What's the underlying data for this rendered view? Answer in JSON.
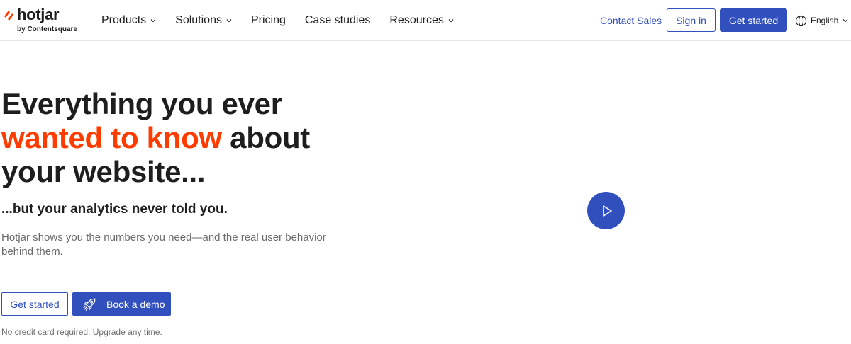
{
  "brand": {
    "name": "hotjar",
    "byline": "by Contentsquare",
    "accent": "#ff3c00",
    "primary": "#324fbe"
  },
  "nav": {
    "items": [
      {
        "label": "Products",
        "dropdown": true
      },
      {
        "label": "Solutions",
        "dropdown": true
      },
      {
        "label": "Pricing",
        "dropdown": false
      },
      {
        "label": "Case studies",
        "dropdown": false
      },
      {
        "label": "Resources",
        "dropdown": true
      }
    ]
  },
  "header_actions": {
    "contact_sales": "Contact Sales",
    "sign_in": "Sign in",
    "get_started": "Get started",
    "language": "English"
  },
  "hero": {
    "title_line1": "Everything you ever",
    "title_accent": "wanted to know",
    "title_line2_rest": " about",
    "title_line3": "your website...",
    "subtitle": "...but your analytics never told you.",
    "description": "Hotjar shows you the numbers you need—and the real user behavior behind them.",
    "cta_primary": "Get started",
    "cta_demo": "Book a demo",
    "fineprint": "No credit card required. Upgrade any time."
  },
  "icons": {
    "logo_mark": "hotjar-flame-icon",
    "chevron": "chevron-down-icon",
    "globe": "globe-icon",
    "rocket": "rocket-icon",
    "play": "play-icon"
  }
}
